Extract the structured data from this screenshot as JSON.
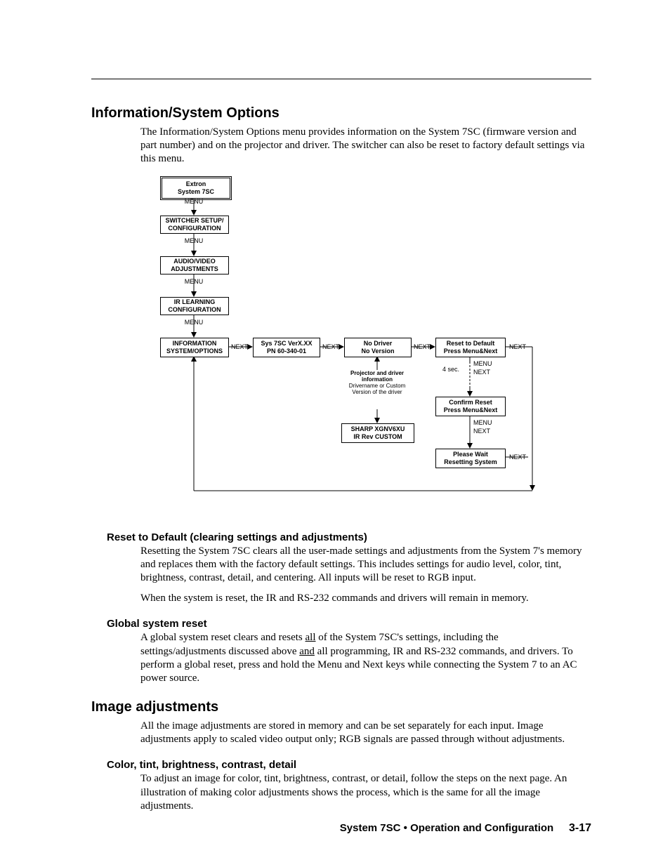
{
  "sections": {
    "info_sys": {
      "heading": "Information/System Options",
      "p1": "The Information/System Options menu provides information on the System 7SC (firmware version and part number) and on the projector and driver.  The switcher can also be reset to factory default settings via this menu."
    },
    "reset_default": {
      "heading": "Reset to Default (clearing settings and adjustments)",
      "p1": "Resetting the System 7SC clears all the user-made settings and adjustments from the System 7's memory and replaces them with the factory default settings.  This includes settings for audio level, color, tint, brightness, contrast, detail, and centering.  All inputs will be reset to RGB input.",
      "p2": "When the system is reset, the IR and RS-232 commands and drivers will remain in memory."
    },
    "global_reset": {
      "heading": "Global system reset",
      "p1_a": "A global system reset clears and resets ",
      "p1_all": "all",
      "p1_b": " of the System 7SC's settings, including the settings/adjustments discussed above ",
      "p1_and": "and",
      "p1_c": " all programming, IR and RS-232 commands, and drivers.  To perform a global reset, press and hold the Menu and Next keys while connecting the System 7 to an AC power source."
    },
    "image_adj": {
      "heading": "Image adjustments",
      "p1": "All the image adjustments are stored in memory and can be set separately for each input.  Image adjustments apply to scaled video output only; RGB signals are passed through without adjustments."
    },
    "ctbcd": {
      "heading": "Color, tint, brightness, contrast, detail",
      "p1": "To adjust an image for color, tint, brightness, contrast, or detail, follow the steps on the next page.  An illustration of making color adjustments shows the process, which is the same for all the image adjustments."
    }
  },
  "diagram": {
    "menu": "MENU",
    "next": "NEXT",
    "foursec": "4 sec.",
    "box_extron_l1": "Extron",
    "box_extron_l2": "System 7SC",
    "box_switcher_l1": "SWITCHER SETUP/",
    "box_switcher_l2": "CONFIGURATION",
    "box_av_l1": "AUDIO/VIDEO",
    "box_av_l2": "ADJUSTMENTS",
    "box_ir_l1": "IR LEARNING",
    "box_ir_l2": "CONFIGURATION",
    "box_info_l1": "INFORMATION",
    "box_info_l2": "SYSTEM/OPTIONS",
    "box_sys_l1": "Sys 7SC  VerX.XX",
    "box_sys_l2": "PN 60-340-01",
    "box_nodrv_l1": "No Driver",
    "box_nodrv_l2": "No Version",
    "box_reset_l1": "Reset to Default",
    "box_reset_l2": "Press Menu&Next",
    "note_proj_l1": "Projector and driver",
    "note_proj_l2": "information",
    "note_proj_l3": "Drivername or Custom",
    "note_proj_l4": "Version of the driver",
    "box_sharp_l1": "SHARP     XGNV6XU",
    "box_sharp_l2": "IR  Rev  CUSTOM",
    "box_confirm_l1": "Confirm Reset",
    "box_confirm_l2": "Press Menu&Next",
    "box_wait_l1": "Please Wait",
    "box_wait_l2": "Resetting System"
  },
  "footer": {
    "text": "System 7SC • Operation and Configuration",
    "page": "3-17"
  }
}
